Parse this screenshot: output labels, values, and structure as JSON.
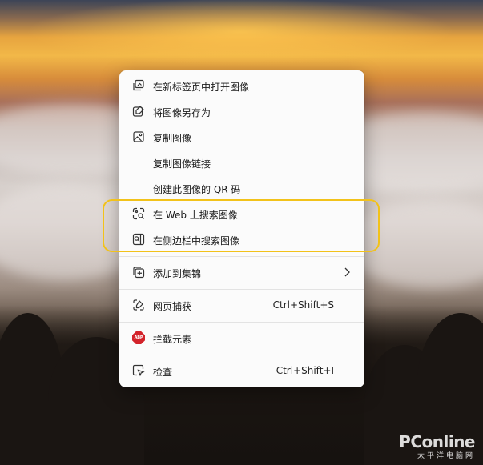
{
  "menu": {
    "items": [
      {
        "label": "在新标签页中打开图像",
        "icon": "open-in-new-tab-icon"
      },
      {
        "label": "将图像另存为",
        "icon": "save-image-icon"
      },
      {
        "label": "复制图像",
        "icon": "copy-image-icon"
      },
      {
        "label": "复制图像链接"
      },
      {
        "label": "创建此图像的 QR 码"
      },
      {
        "label": "在 Web 上搜索图像",
        "icon": "visual-search-icon"
      },
      {
        "label": "在侧边栏中搜索图像",
        "icon": "sidebar-search-icon"
      },
      {
        "label": "添加到集锦",
        "icon": "collections-icon"
      },
      {
        "label": "网页捕获",
        "shortcut": "Ctrl+Shift+S",
        "icon": "web-capture-icon"
      },
      {
        "label": "拦截元素",
        "icon": "abp-icon"
      },
      {
        "label": "检查",
        "shortcut": "Ctrl+Shift+I",
        "icon": "inspect-icon"
      }
    ],
    "abp_text": "ABP"
  },
  "highlight_color": "#f2c21a",
  "watermark": {
    "brand": "PConline",
    "sub": "太平洋电脑网"
  }
}
